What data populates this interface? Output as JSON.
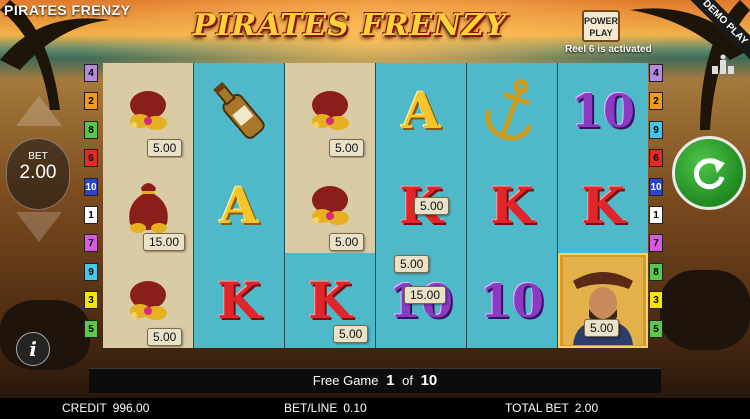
{
  "header": {
    "game_title": "PIRATES FRENZY",
    "logo_text": "PIRATES FRENZY",
    "power_play_label": "POWER PLAY",
    "reel_status": "Reel 6 is activated",
    "demo_label": "DEMO PLAY"
  },
  "bet_control": {
    "label": "BET",
    "value": "2.00"
  },
  "paylines_left": [
    "4",
    "2",
    "8",
    "6",
    "10",
    "1",
    "7",
    "9",
    "3",
    "5"
  ],
  "paylines_right": [
    "4",
    "2",
    "9",
    "6",
    "10",
    "1",
    "7",
    "8",
    "3",
    "5"
  ],
  "payline_colors": {
    "1": "#ffffff",
    "2": "#f29a1c",
    "3": "#f5e600",
    "4": "#b58adc",
    "5": "#5cc94a",
    "6": "#e42a22",
    "7": "#d55ae0",
    "8": "#58c84a",
    "9": "#46c6e8",
    "10": "#2a44d0"
  },
  "reels": [
    {
      "bg": "sand",
      "symbols": [
        {
          "type": "treasure",
          "value": "5.00"
        },
        {
          "type": "money-bag",
          "value": "15.00"
        },
        {
          "type": "treasure",
          "value": "5.00"
        }
      ]
    },
    {
      "bg": "teal",
      "symbols": [
        {
          "type": "bottle",
          "value": ""
        },
        {
          "type": "A",
          "value": ""
        },
        {
          "type": "K",
          "value": ""
        }
      ]
    },
    {
      "bg": "sand",
      "symbols": [
        {
          "type": "treasure",
          "value": "5.00"
        },
        {
          "type": "treasure",
          "value": "5.00"
        },
        {
          "type": "K",
          "value": "5.00"
        }
      ]
    },
    {
      "bg": "teal",
      "symbols": [
        {
          "type": "A",
          "value": ""
        },
        {
          "type": "K",
          "value": "5.00"
        },
        {
          "type": "10",
          "value": "5.00 / 15.00"
        }
      ]
    },
    {
      "bg": "teal",
      "symbols": [
        {
          "type": "anchor",
          "value": ""
        },
        {
          "type": "K",
          "value": ""
        },
        {
          "type": "10",
          "value": ""
        }
      ]
    },
    {
      "bg": "teal",
      "symbols": [
        {
          "type": "10",
          "value": ""
        },
        {
          "type": "K",
          "value": ""
        },
        {
          "type": "pirate",
          "value": "5.00"
        }
      ]
    }
  ],
  "symbol_text": {
    "A": "A",
    "K": "K",
    "ten": "10",
    "tag_5": "5.00",
    "tag_15": "15.00"
  },
  "free_game": {
    "label": "Free Game",
    "current": "1",
    "of_label": "of",
    "total": "10"
  },
  "footer": {
    "credit_label": "CREDIT",
    "credit_value": "996.00",
    "betline_label": "BET/LINE",
    "betline_value": "0.10",
    "totalbet_label": "TOTAL BET",
    "totalbet_value": "2.00"
  },
  "icons": {
    "spin": "refresh-arrow-icon",
    "info": "info-icon",
    "paytable": "paytable-icon"
  }
}
